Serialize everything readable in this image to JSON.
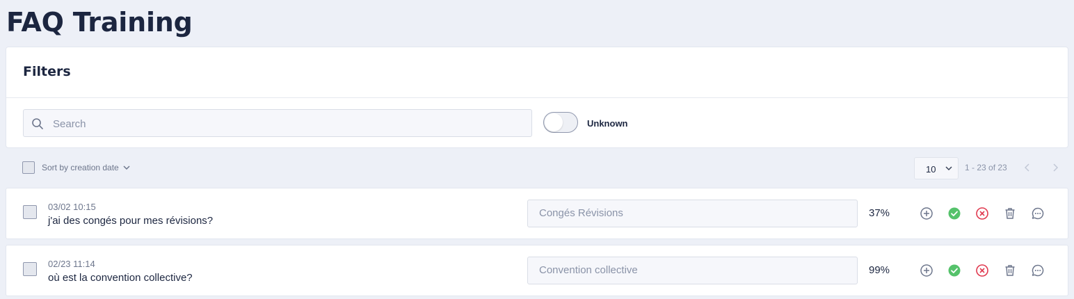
{
  "page": {
    "title": "FAQ Training"
  },
  "filters": {
    "title": "Filters",
    "search_placeholder": "Search",
    "toggle_label": "Unknown"
  },
  "toolbar": {
    "sort_label": "Sort by creation date",
    "page_size": "10",
    "range": "1 - 23 of 23"
  },
  "colors": {
    "validate": "#55c26b",
    "reject": "#e0394f",
    "icon_gray": "#6d768c"
  },
  "rows": [
    {
      "date": "03/02 10:15",
      "question": "j'ai des congés pour mes révisions?",
      "answer": "Congés Révisions",
      "percent": "37%"
    },
    {
      "date": "02/23 11:14",
      "question": "où est la convention collective?",
      "answer": "Convention collective",
      "percent": "99%"
    }
  ]
}
